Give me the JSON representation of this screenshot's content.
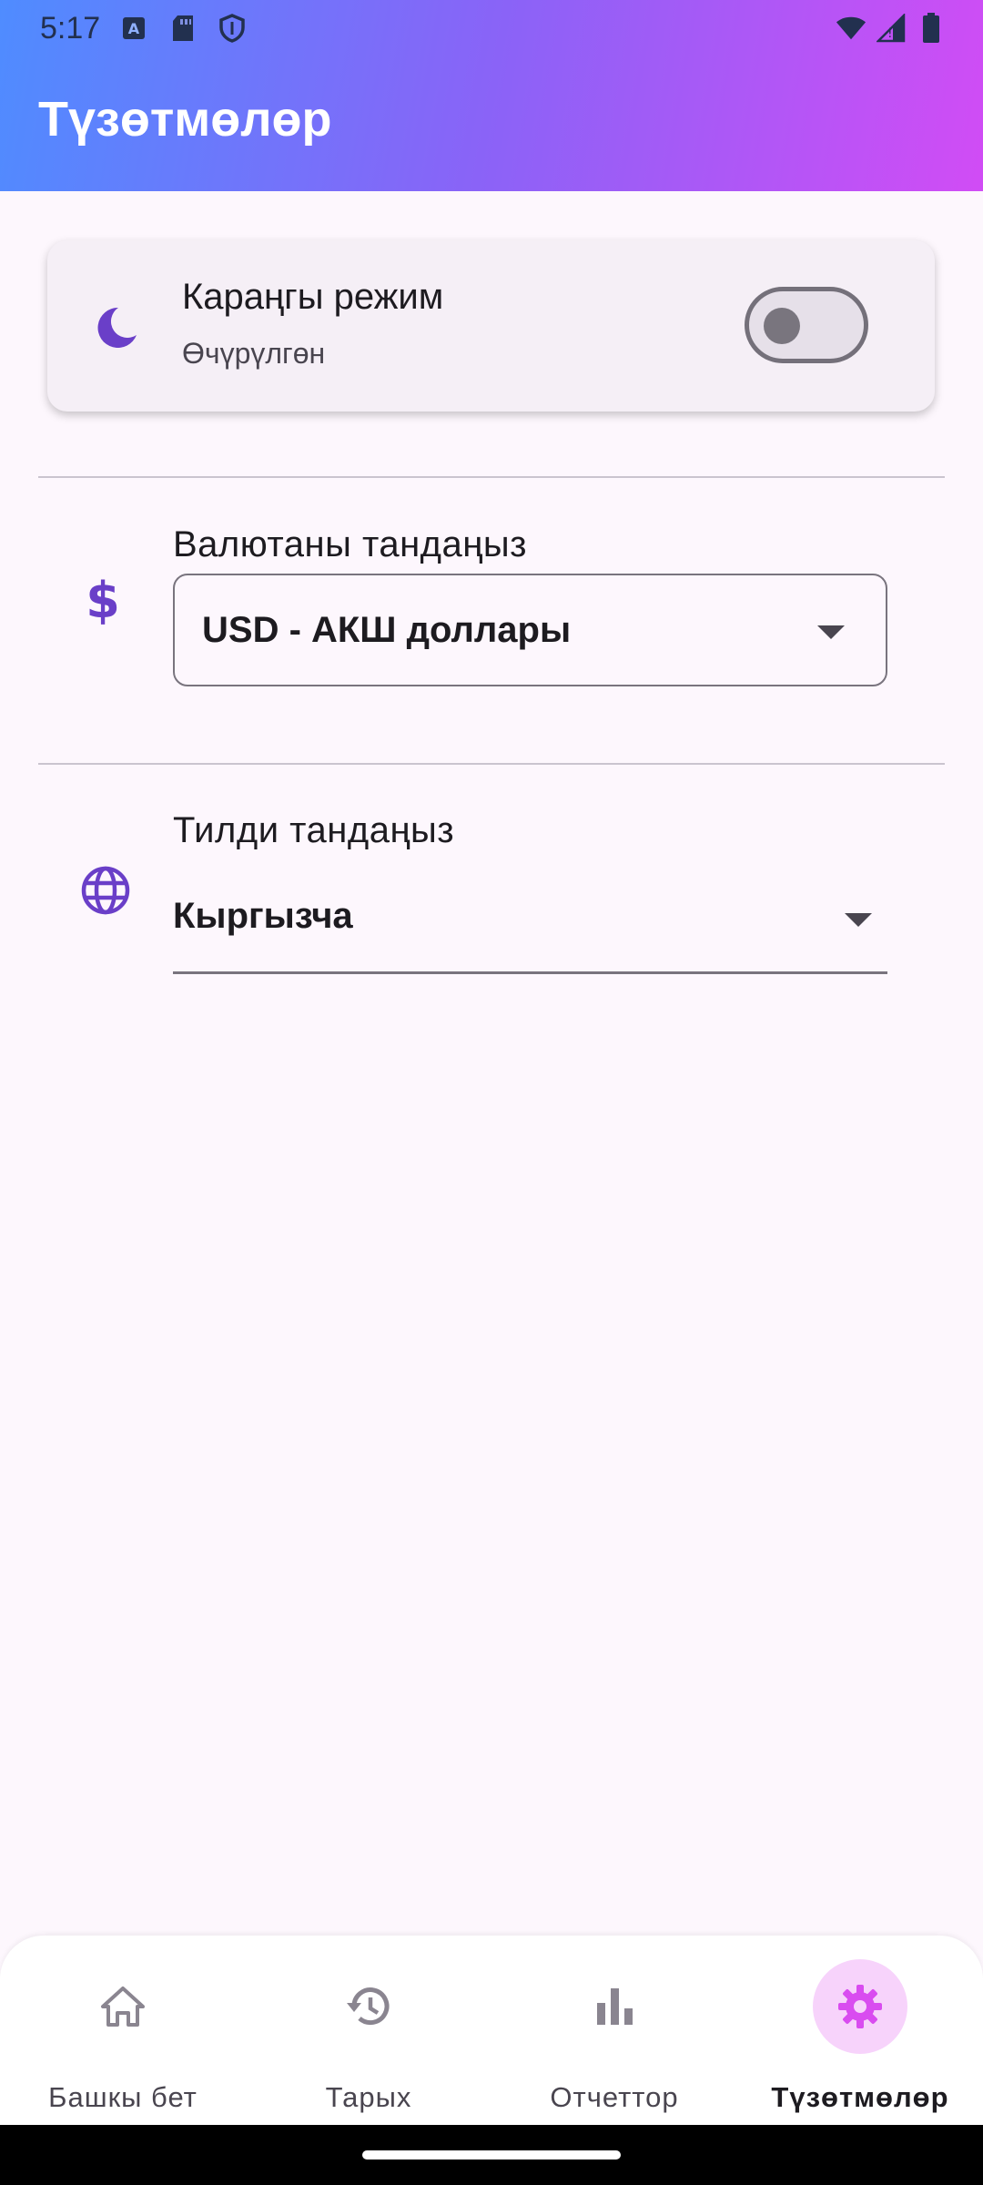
{
  "status_bar": {
    "time": "5:17",
    "icons": [
      "a-notification-icon",
      "sd-card-icon",
      "shield-icon",
      "wifi-icon",
      "signal-icon",
      "battery-icon"
    ]
  },
  "header": {
    "title": "Түзөтмөлөр",
    "gradient": [
      "#4f8cff",
      "#8a63f7",
      "#d14cf5"
    ]
  },
  "dark_mode": {
    "icon": "moon-icon",
    "title": "Караңгы режим",
    "status": "Өчүрүлгөн",
    "enabled": false
  },
  "currency": {
    "icon": "dollar-icon",
    "label": "Валютаны тандаңыз",
    "selected": "USD - АКШ доллары"
  },
  "language": {
    "icon": "globe-icon",
    "label": "Тилди тандаңыз",
    "selected": "Кыргызча"
  },
  "bottom_nav": {
    "items": [
      {
        "label": "Башкы бет",
        "icon": "home-icon",
        "active": false
      },
      {
        "label": "Тарых",
        "icon": "history-icon",
        "active": false
      },
      {
        "label": "Отчеттор",
        "icon": "bar-chart-icon",
        "active": false
      },
      {
        "label": "Түзөтмөлөр",
        "icon": "gear-icon",
        "active": true
      }
    ]
  },
  "colors": {
    "accent": "#6a3fc8",
    "active_nav_icon": "#d94cf0",
    "active_nav_bg": "#f7d3fb",
    "background": "#fdf7fd"
  }
}
